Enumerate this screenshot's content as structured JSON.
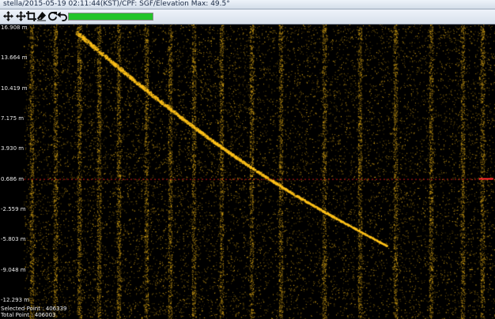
{
  "window": {
    "title": "stella/2015-05-19 02:11:44(KST)/CPF: SGF/Elevation Max: 49.5°"
  },
  "toolbar": {
    "tools": [
      {
        "name": "move-tool",
        "icon": "move-icon"
      },
      {
        "name": "pan-tool",
        "icon": "pan-arrows-icon"
      },
      {
        "name": "crop-tool",
        "icon": "crop-icon"
      },
      {
        "name": "eraser-tool",
        "icon": "eraser-icon"
      },
      {
        "name": "redo-tool",
        "icon": "rotate-icon"
      },
      {
        "name": "undo-tool",
        "icon": "undo-arrow-icon"
      }
    ],
    "progress_fraction": 1.0,
    "progress_color": "#22c42a"
  },
  "plot": {
    "background": "#000000",
    "point_color": "#ffc21a",
    "ref_line_color": "#ff2020",
    "y_ticks": [
      "16.908 m",
      "13.664 m",
      "10.419 m",
      "7.175 m",
      "3.930 m",
      "0.686 m",
      "-2.559 m",
      "-5.803 m",
      "-9.048 m",
      "-12.293 m"
    ],
    "y_tick_values": [
      16.908,
      13.664,
      10.419,
      7.175,
      3.93,
      0.686,
      -2.559,
      -5.803,
      -9.048,
      -12.293
    ],
    "ref_line_value": 0.686
  },
  "status": {
    "selected_label": "Selected Point : ",
    "selected_value": "406339",
    "total_label": "Total Point : ",
    "total_value": "406003"
  }
}
